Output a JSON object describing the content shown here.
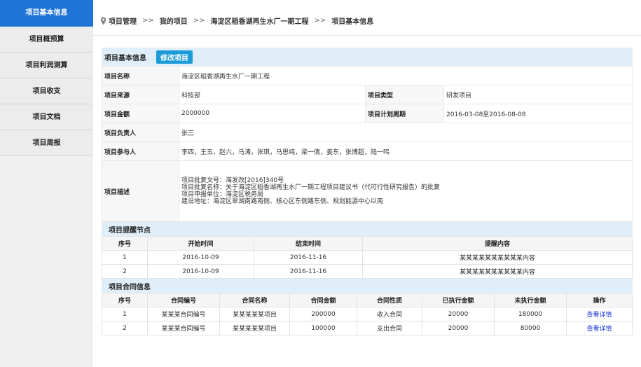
{
  "sidebar": {
    "items": [
      {
        "label": "项目基本信息",
        "active": true
      },
      {
        "label": "项目概预算",
        "active": false
      },
      {
        "label": "项目利润测算",
        "active": false
      },
      {
        "label": "项目收支",
        "active": false
      },
      {
        "label": "项目文档",
        "active": false
      },
      {
        "label": "项目周报",
        "active": false
      }
    ]
  },
  "breadcrumb": {
    "items": [
      "项目管理",
      "我的项目",
      "海淀区稻香湖再生水厂一期工程",
      "项目基本信息"
    ],
    "separator": ">>"
  },
  "basic_info": {
    "title": "项目基本信息",
    "edit_button": "修改项目",
    "name_label": "项目名称",
    "name_value": "海淀区稻香湖再生水厂一期工程",
    "source_label": "项目来源",
    "source_value": "科技部",
    "type_label": "项目类型",
    "type_value": "研发项目",
    "amount_label": "项目金额",
    "amount_value": "2000000",
    "period_label": "项目计划周期",
    "period_value": "2016-03-08至2016-08-08",
    "leader_label": "项目负责人",
    "leader_value": "张三",
    "members_label": "项目参与人",
    "members_value": "李四，王五，赵六，马涛，张琪，马思纯，梁一倩，姜东，张博超，陆一鸣",
    "desc_label": "项目描述",
    "desc_lines": [
      "项目批复文号：海发改[2016]340号",
      "项目批复名称：关于海淀区稻香湖再生水厂一期工程项目建议书（代可行性研究报告）的批复",
      "项目申报单位：海淀区税务局",
      "建设地址：海淀区翠湖南路南侧、核心区东侧路东侧、规划能源中心以南"
    ]
  },
  "reminders": {
    "title": "项目提醒节点",
    "headers": [
      "序号",
      "开始时间",
      "结束时间",
      "提醒内容"
    ],
    "rows": [
      [
        "1",
        "2016-10-09",
        "2016-11-16",
        "某某某某某某某某某某内容"
      ],
      [
        "2",
        "2016-10-09",
        "2016-11-16",
        "某某某某某某某某某某内容"
      ]
    ]
  },
  "contracts": {
    "title": "项目合同信息",
    "headers": [
      "序号",
      "合同编号",
      "合同名称",
      "合同金额",
      "合同性质",
      "已执行金额",
      "未执行金额",
      "操作"
    ],
    "rows": [
      [
        "1",
        "某某某合同编号",
        "某某某某某项目",
        "200000",
        "收入合同",
        "20000",
        "180000",
        "查看详情"
      ],
      [
        "2",
        "某某某合同编号",
        "某某某某某项目",
        "100000",
        "支出合同",
        "20000",
        "80000",
        "查看详情"
      ]
    ]
  }
}
